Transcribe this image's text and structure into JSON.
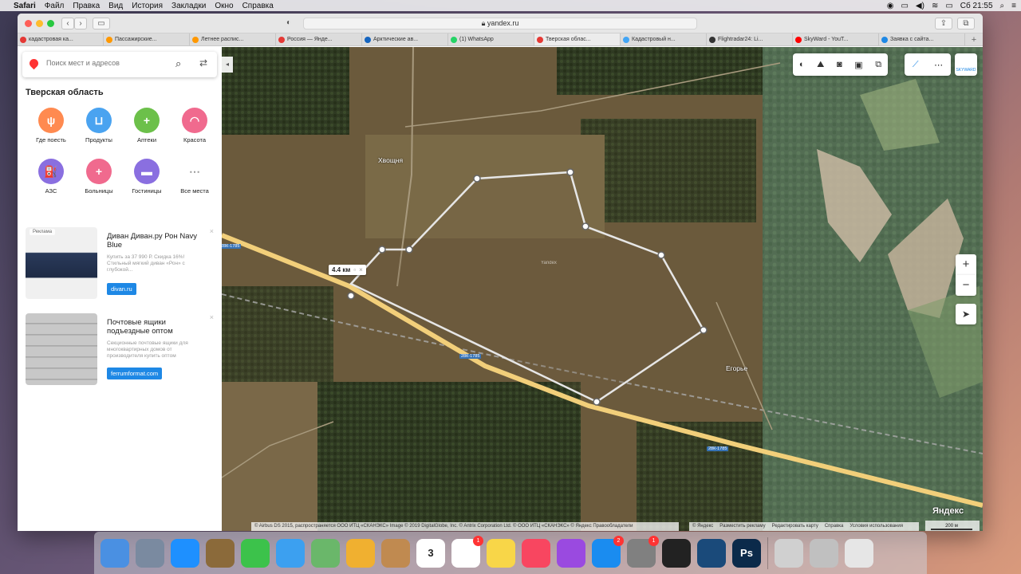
{
  "menubar": {
    "app_name": "Safari",
    "menus": [
      "Файл",
      "Правка",
      "Вид",
      "История",
      "Закладки",
      "Окно",
      "Справка"
    ],
    "clock": "Сб 21:55"
  },
  "browser": {
    "url": "yandex.ru",
    "tabs": [
      {
        "title": "кадастровая ка...",
        "color": "#e53935"
      },
      {
        "title": "Пассажирские...",
        "color": "#ff9800"
      },
      {
        "title": "Летнее распис...",
        "color": "#ff9800"
      },
      {
        "title": "Россия — Янде...",
        "color": "#e53935"
      },
      {
        "title": "Арктические ав...",
        "color": "#1565c0"
      },
      {
        "title": "(1) WhatsApp",
        "color": "#25d366"
      },
      {
        "title": "Тверская облас...",
        "color": "#e53935"
      },
      {
        "title": "Кадастровый н...",
        "color": "#42a5f5"
      },
      {
        "title": "Flightradar24: Li...",
        "color": "#333333"
      },
      {
        "title": "SkyWard - YouT...",
        "color": "#ff0000"
      },
      {
        "title": "Заявка с сайта...",
        "color": "#1e88e5"
      }
    ],
    "active_tab": 6
  },
  "sidebar": {
    "search_placeholder": "Поиск мест и адресов",
    "region_title": "Тверская область",
    "categories": [
      {
        "label": "Где поесть",
        "color": "#ff8a50",
        "icon": "fork-knife-icon",
        "glyph": "ψ"
      },
      {
        "label": "Продукты",
        "color": "#4aa3f0",
        "icon": "basket-icon",
        "glyph": "⊔"
      },
      {
        "label": "Аптеки",
        "color": "#6cc04a",
        "icon": "pharmacy-cross-icon",
        "glyph": "+"
      },
      {
        "label": "Красота",
        "color": "#f06a8e",
        "icon": "lips-icon",
        "glyph": "◠"
      },
      {
        "label": "АЗС",
        "color": "#8a6fe0",
        "icon": "fuel-icon",
        "glyph": "⛽"
      },
      {
        "label": "Больницы",
        "color": "#f06a8e",
        "icon": "hospital-cross-icon",
        "glyph": "+"
      },
      {
        "label": "Гостиницы",
        "color": "#8a6fe0",
        "icon": "bed-icon",
        "glyph": "▬"
      },
      {
        "label": "Все места",
        "color": "#ffffff",
        "icon": "dots-grid-icon",
        "glyph": "⋯"
      }
    ],
    "ads": [
      {
        "tag": "Реклама",
        "title": "Диван Диван.ру Рон Navy Blue",
        "description": "Купить за 37 990 Р. Скидка 16%! Стильный мягкий диван «Рон» с глубокой...",
        "button": "divan.ru"
      },
      {
        "title": "Почтовые ящики подъездные оптом",
        "description": "Секционные почтовые ящики для многоквартирных домов от производителя купить оптом",
        "button": "ferrumformat.com"
      }
    ]
  },
  "map": {
    "measure_label": "4.4 км",
    "places": [
      "Хвощня",
      "Егорье"
    ],
    "road_label": "28К-1785",
    "watermark": "Yandex",
    "copyright": "© Airbus DS 2015, распространяется ООО ИТЦ «СКАНЭКС» Image © 2019 DigitalGlobe, Inc. © Antrix Corporation Ltd. © ООО ИТЦ «СКАНЭКС» © Яндекс  Правообладатели",
    "footer_links": [
      "© Яндекс",
      "Разместить рекламу",
      "Редактировать карту",
      "Справка",
      "Условия использования"
    ],
    "brand": "Яндекс",
    "scale_label": "200 м",
    "zoom_in": "+",
    "zoom_out": "−"
  },
  "dock": {
    "apps": [
      {
        "name": "finder",
        "color": "#4a90e2"
      },
      {
        "name": "launchpad",
        "color": "#7a8aa0"
      },
      {
        "name": "safari",
        "color": "#1e90ff"
      },
      {
        "name": "preview-eagle",
        "color": "#8b6a3a"
      },
      {
        "name": "facetime",
        "color": "#3cc24b"
      },
      {
        "name": "messages",
        "color": "#3ca0f0"
      },
      {
        "name": "maps",
        "color": "#6ab76a"
      },
      {
        "name": "photos",
        "color": "#f0b030"
      },
      {
        "name": "contacts",
        "color": "#c08a50"
      },
      {
        "name": "calendar",
        "color": "#ffffff",
        "label": "3"
      },
      {
        "name": "reminders",
        "color": "#ffffff",
        "badge": "1"
      },
      {
        "name": "notes",
        "color": "#f8d648"
      },
      {
        "name": "music",
        "color": "#f84660"
      },
      {
        "name": "podcasts",
        "color": "#9a4ae0"
      },
      {
        "name": "app-store",
        "color": "#1a8cf0",
        "badge": "2"
      },
      {
        "name": "system-preferences",
        "color": "#808080",
        "badge": "1"
      },
      {
        "name": "final-cut-pro",
        "color": "#222222"
      },
      {
        "name": "quicktime",
        "color": "#1a4a7a"
      },
      {
        "name": "photoshop",
        "color": "#0b2a4a",
        "label": "Ps"
      },
      {
        "name": "screenshot-1",
        "color": "#d0d0d0"
      },
      {
        "name": "screenshot-2",
        "color": "#c0c0c0"
      },
      {
        "name": "trash",
        "color": "#e6e6e6"
      }
    ]
  }
}
